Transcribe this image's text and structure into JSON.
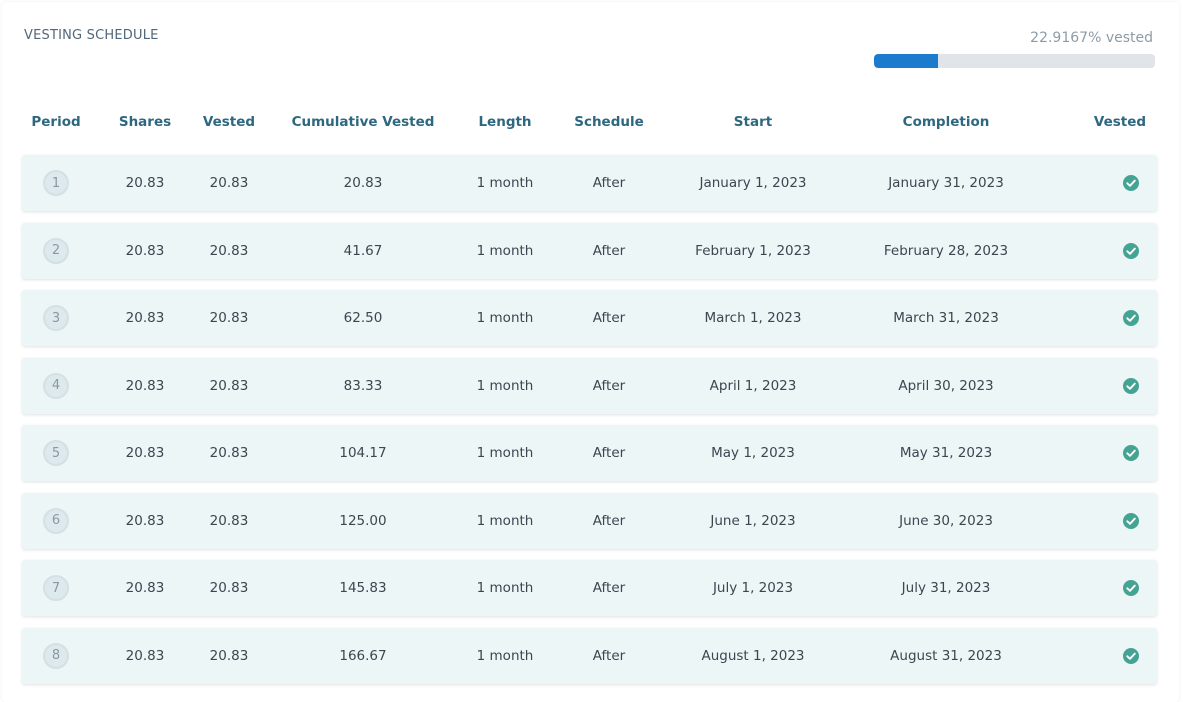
{
  "section": {
    "title": "VESTING SCHEDULE",
    "vested_percent_label": "22.9167% vested",
    "vested_fraction": 0.229167
  },
  "colors": {
    "progress_fill": "#1b7bcd",
    "progress_track": "#e1e5e9",
    "header_text": "#2d6880",
    "row_bg": "#ecf6f7",
    "check_icon": "#45a394"
  },
  "columns": [
    "Period",
    "Shares",
    "Vested",
    "Cumulative Vested",
    "Length",
    "Schedule",
    "Start",
    "Completion",
    "Vested"
  ],
  "rows": [
    {
      "period": "1",
      "shares": "20.83",
      "vested": "20.83",
      "cumulative": "20.83",
      "length": "1 month",
      "schedule": "After",
      "start": "January 1, 2023",
      "completion": "January 31, 2023",
      "vested_icon": "check-circle-icon"
    },
    {
      "period": "2",
      "shares": "20.83",
      "vested": "20.83",
      "cumulative": "41.67",
      "length": "1 month",
      "schedule": "After",
      "start": "February 1, 2023",
      "completion": "February 28, 2023",
      "vested_icon": "check-circle-icon"
    },
    {
      "period": "3",
      "shares": "20.83",
      "vested": "20.83",
      "cumulative": "62.50",
      "length": "1 month",
      "schedule": "After",
      "start": "March 1, 2023",
      "completion": "March 31, 2023",
      "vested_icon": "check-circle-icon"
    },
    {
      "period": "4",
      "shares": "20.83",
      "vested": "20.83",
      "cumulative": "83.33",
      "length": "1 month",
      "schedule": "After",
      "start": "April 1, 2023",
      "completion": "April 30, 2023",
      "vested_icon": "check-circle-icon"
    },
    {
      "period": "5",
      "shares": "20.83",
      "vested": "20.83",
      "cumulative": "104.17",
      "length": "1 month",
      "schedule": "After",
      "start": "May 1, 2023",
      "completion": "May 31, 2023",
      "vested_icon": "check-circle-icon"
    },
    {
      "period": "6",
      "shares": "20.83",
      "vested": "20.83",
      "cumulative": "125.00",
      "length": "1 month",
      "schedule": "After",
      "start": "June 1, 2023",
      "completion": "June 30, 2023",
      "vested_icon": "check-circle-icon"
    },
    {
      "period": "7",
      "shares": "20.83",
      "vested": "20.83",
      "cumulative": "145.83",
      "length": "1 month",
      "schedule": "After",
      "start": "July 1, 2023",
      "completion": "July 31, 2023",
      "vested_icon": "check-circle-icon"
    },
    {
      "period": "8",
      "shares": "20.83",
      "vested": "20.83",
      "cumulative": "166.67",
      "length": "1 month",
      "schedule": "After",
      "start": "August 1, 2023",
      "completion": "August 31, 2023",
      "vested_icon": "check-circle-icon"
    }
  ]
}
